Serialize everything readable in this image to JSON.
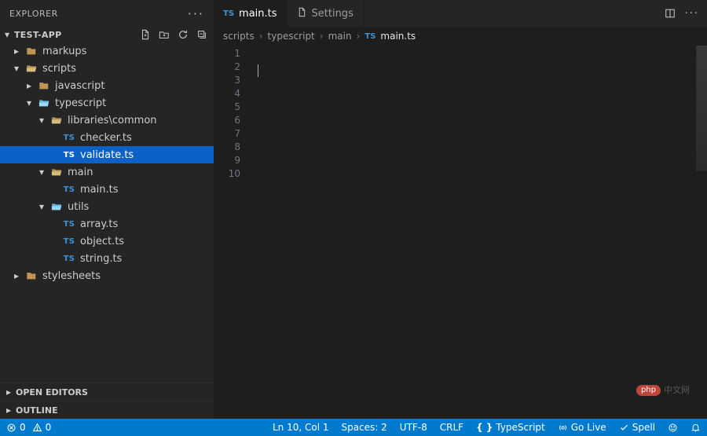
{
  "explorer": {
    "title": "EXPLORER",
    "more_icon": "···"
  },
  "project": {
    "name": "TEST-APP",
    "actions": [
      "new-file",
      "new-folder",
      "refresh",
      "collapse-all"
    ]
  },
  "tree": [
    {
      "type": "folder",
      "label": "markups",
      "expanded": false,
      "indent": 1
    },
    {
      "type": "folder",
      "label": "scripts",
      "expanded": true,
      "indent": 1
    },
    {
      "type": "folder",
      "label": "javascript",
      "expanded": false,
      "indent": 2
    },
    {
      "type": "folder",
      "label": "typescript",
      "expanded": true,
      "indent": 2,
      "accent": true
    },
    {
      "type": "folder",
      "label": "libraries\\common",
      "expanded": true,
      "indent": 3
    },
    {
      "type": "ts",
      "label": "checker.ts",
      "indent": 4
    },
    {
      "type": "ts",
      "label": "validate.ts",
      "indent": 4,
      "selected": true
    },
    {
      "type": "folder",
      "label": "main",
      "expanded": true,
      "indent": 3
    },
    {
      "type": "ts",
      "label": "main.ts",
      "indent": 4
    },
    {
      "type": "folder",
      "label": "utils",
      "expanded": true,
      "indent": 3,
      "accent": true
    },
    {
      "type": "ts",
      "label": "array.ts",
      "indent": 4
    },
    {
      "type": "ts",
      "label": "object.ts",
      "indent": 4
    },
    {
      "type": "ts",
      "label": "string.ts",
      "indent": 4
    },
    {
      "type": "folder",
      "label": "stylesheets",
      "expanded": false,
      "indent": 1
    }
  ],
  "panels": {
    "open_editors": "OPEN EDITORS",
    "outline": "OUTLINE"
  },
  "tabs": [
    {
      "kind": "ts",
      "label": "main.ts",
      "active": true
    },
    {
      "kind": "page",
      "label": "Settings",
      "active": false
    }
  ],
  "breadcrumbs": {
    "parts": [
      "scripts",
      "typescript",
      "main"
    ],
    "file": "main.ts"
  },
  "editor": {
    "line_count": 10,
    "cursor_line": 2
  },
  "status": {
    "errors": "0",
    "warnings": "0",
    "line_col": "Ln 10, Col 1",
    "spaces": "Spaces: 2",
    "encoding": "UTF-8",
    "eol": "CRLF",
    "language": "TypeScript",
    "go_live": "Go Live",
    "spell": "Spell"
  },
  "watermark": {
    "brand": "php",
    "text": "中文网"
  }
}
